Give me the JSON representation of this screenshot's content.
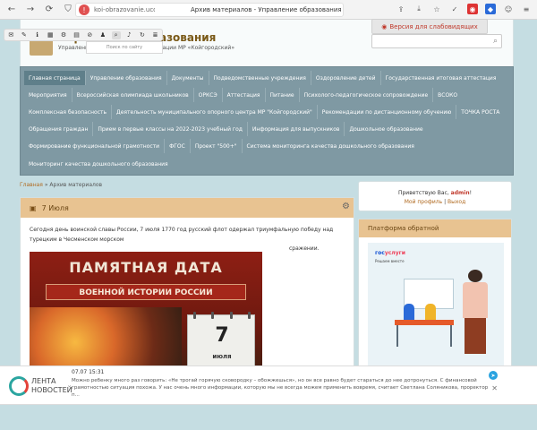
{
  "browser": {
    "url": "koi-obrazovanie.ucoz.ru",
    "tab_title": "Архив материалов - Управление образования"
  },
  "header": {
    "title": "Управление образования",
    "subtitle": "Управление образования администрации МР «Койгородский»",
    "search_dropdown": "Поиск по сайту",
    "vision_label": "Версия для слабовидящих"
  },
  "nav": {
    "rows": [
      [
        "Главная страница",
        "Управление образования",
        "Документы",
        "Подведомственные учреждения",
        "Оздоровление детей",
        "Государственная итоговая аттестация"
      ],
      [
        "Мероприятия",
        "Всероссийская олимпиада школьников",
        "ОРКСЭ",
        "Аттестация",
        "Питание",
        "Психолого-педагогическое сопровождение",
        "ВСОКО"
      ],
      [
        "Комплексная безопасность",
        "Деятельность муниципального опорного центра МР \"Койгородский\"",
        "Рекомендации по дистанционному обучению",
        "ТОЧКА РОСТА"
      ],
      [
        "Обращения граждан",
        "Прием в первые классы на 2022-2023 учебный год",
        "Информация для выпускников",
        "Дошкольное образование"
      ],
      [
        "Формирование функциональной грамотности",
        "ФГОС",
        "Проект \"500+\"",
        "Система мониторинга качества дошкольного образования"
      ],
      [
        "Мониторинг качества дошкольного образования"
      ]
    ]
  },
  "breadcrumb": {
    "home": "Главная",
    "sep": " » ",
    "current": "Архив материалов"
  },
  "article": {
    "title": "7 Июля",
    "text": "Сегодня день воинской славы России, 7 июля 1770 год русский флот одержал триумфальную победу над турецким в Чесменском морском",
    "side_text": "сражении.",
    "poster": {
      "line1": "ПАМЯТНАЯ ДАТА",
      "line2": "ВОЕННОЙ ИСТОРИИ РОССИИ",
      "day": "7",
      "month": "июля"
    }
  },
  "user": {
    "greeting": "Приветствую Вас,",
    "name": "admin",
    "profile_link": "Мой профиль",
    "sep": " | ",
    "logout_link": "Выход"
  },
  "platform": {
    "title": "Платформа обратной",
    "gu_part1": "гос",
    "gu_part2": "услуги",
    "gu_sub": "Решаем вместе"
  },
  "news": {
    "logo_line1": "ЛЕНТА",
    "logo_line2": "НОВОСТЕЙ",
    "time": "07.07 15:31",
    "text": "Можно ребенку много раз говорить: «Не трогай горячую сковородку – обожжешься», но он все равно будет стараться до нее дотронуться. С финансовой грамотностью ситуация похожа. У нас очень много информации, которую мы не всегда можем применить вовремя, считает Светлана Соляникова, проректор п..."
  }
}
